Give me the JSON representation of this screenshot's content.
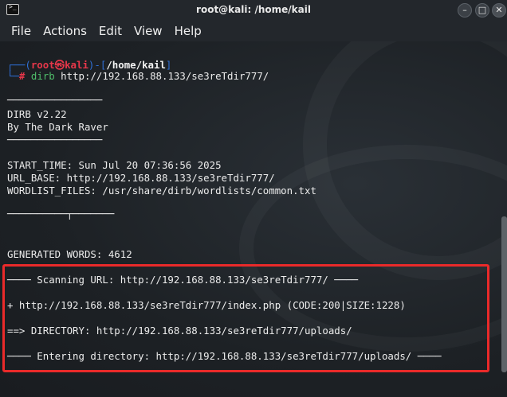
{
  "window": {
    "title": "root@kali: /home/kail",
    "app_icon_glyph": ">_",
    "minimize_glyph": "–",
    "maximize_glyph": "□",
    "close_glyph": "✕"
  },
  "menu": [
    "File",
    "Actions",
    "Edit",
    "View",
    "Help"
  ],
  "prompt": {
    "frame_top": "┌──(",
    "user_host": "root㉿kali",
    "sep": ")-[",
    "path": "/home/kail",
    "close": "]",
    "frame_bottom": "└─",
    "hash": "#",
    "command": "dirb",
    "argument": "http://192.168.88.133/se3reTdir777/"
  },
  "output": {
    "rule1": "────────────────",
    "version": "DIRB v2.22",
    "author": "By The Dark Raver",
    "rule2": "────────────────",
    "start_time": "START_TIME: Sun Jul 20 07:36:56 2025",
    "url_base": "URL_BASE: http://192.168.88.133/se3reTdir777/",
    "wordlist": "WORDLIST_FILES: /usr/share/dirb/wordlists/common.txt",
    "rule3": "──────────┬───────",
    "generated": "GENERATED WORDS: 4612",
    "scanning": "──── Scanning URL: http://192.168.88.133/se3reTdir777/ ────",
    "found": "+ http://192.168.88.133/se3reTdir777/index.php (CODE:200|SIZE:1228)",
    "directory": "==> DIRECTORY: http://192.168.88.133/se3reTdir777/uploads/",
    "entering": "──── Entering directory: http://192.168.88.133/se3reTdir777/uploads/ ────"
  },
  "colors": {
    "highlight_border": "#ea2a2a",
    "prompt_blue": "#2f6fd6",
    "prompt_red": "#e8374a",
    "command_green": "#4fbf6b"
  }
}
